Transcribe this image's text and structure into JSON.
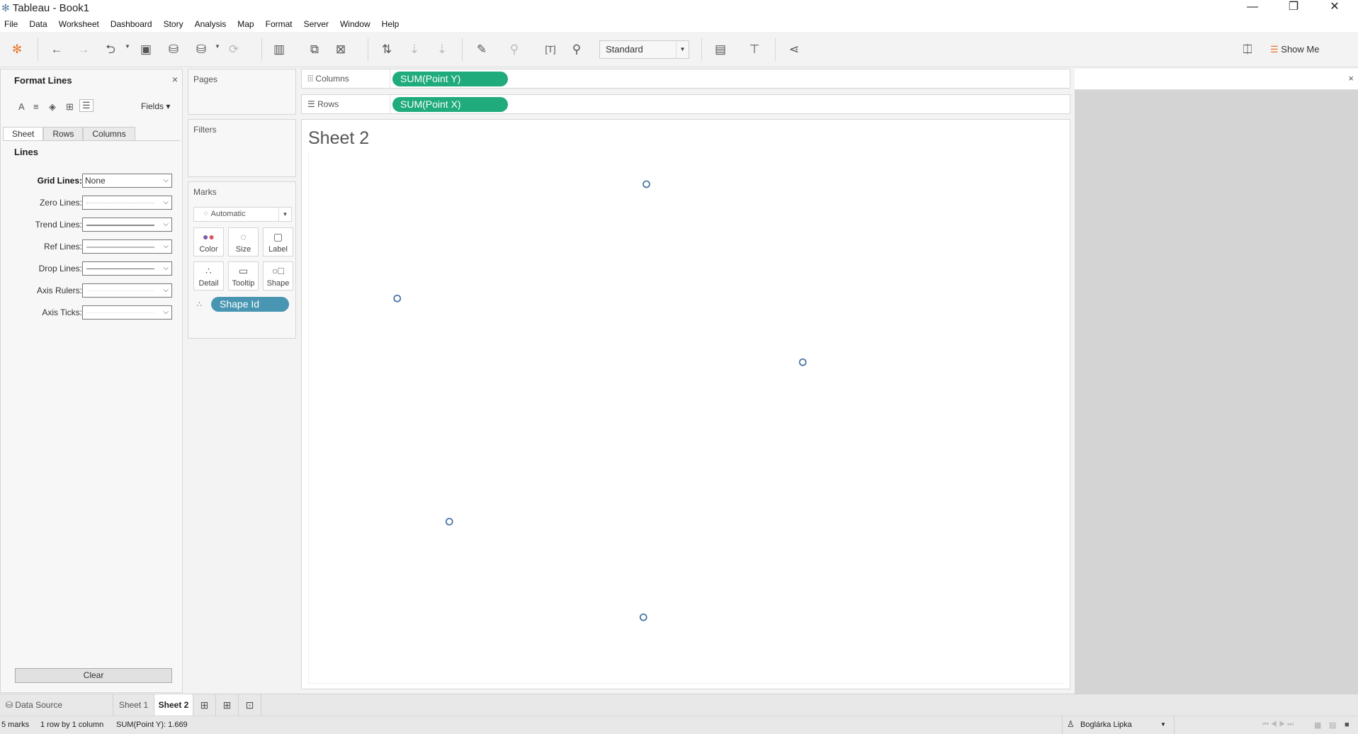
{
  "window": {
    "title": "Tableau - Book1",
    "minimize": "—",
    "restore": "❐",
    "close": "✕"
  },
  "menu": [
    "File",
    "Data",
    "Worksheet",
    "Dashboard",
    "Story",
    "Analysis",
    "Map",
    "Format",
    "Server",
    "Window",
    "Help"
  ],
  "toolbar": {
    "fit": "Standard",
    "show_me": "Show Me"
  },
  "format_panel": {
    "title": "Format Lines",
    "close": "×",
    "fields": "Fields ▾",
    "tabs": [
      "Sheet",
      "Rows",
      "Columns"
    ],
    "section": "Lines",
    "rows": [
      {
        "label": "Grid Lines:",
        "value": "None",
        "style": "none"
      },
      {
        "label": "Zero Lines:",
        "value": "",
        "style": "dotted"
      },
      {
        "label": "Trend Lines:",
        "value": "",
        "style": "solid-thick"
      },
      {
        "label": "Ref Lines:",
        "value": "",
        "style": "solid-light"
      },
      {
        "label": "Drop Lines:",
        "value": "",
        "style": "solid"
      },
      {
        "label": "Axis Rulers:",
        "value": "",
        "style": "faint"
      },
      {
        "label": "Axis Ticks:",
        "value": "",
        "style": "faint"
      }
    ],
    "clear": "Clear"
  },
  "cards": {
    "pages": "Pages",
    "filters": "Filters",
    "marks": "Marks",
    "mark_type": "Automatic",
    "buttons": [
      {
        "label": "Color",
        "icon": "color-icon"
      },
      {
        "label": "Size",
        "icon": "size-icon"
      },
      {
        "label": "Label",
        "icon": "label-icon"
      },
      {
        "label": "Detail",
        "icon": "detail-icon"
      },
      {
        "label": "Tooltip",
        "icon": "tooltip-icon"
      },
      {
        "label": "Shape",
        "icon": "shape-icon"
      }
    ],
    "detail_pill": "Shape Id"
  },
  "shelves": {
    "columns_label": "Columns",
    "columns_pill": "SUM(Point Y)",
    "rows_label": "Rows",
    "rows_pill": "SUM(Point X)"
  },
  "colors": {
    "pill_green": "#1fab7c",
    "pill_blue": "#4996b2",
    "mark": "#4e79a7"
  },
  "chart_data": {
    "type": "scatter",
    "title": "Sheet 2",
    "xlabel": "SUM(Point Y)",
    "ylabel": "SUM(Point X)",
    "grid": false,
    "xlim": [
      0,
      1
    ],
    "ylim": [
      0,
      1
    ],
    "points": [
      {
        "x": 0.447,
        "y": 0.94
      },
      {
        "x": 0.117,
        "y": 0.725
      },
      {
        "x": 0.654,
        "y": 0.605
      },
      {
        "x": 0.186,
        "y": 0.305
      },
      {
        "x": 0.443,
        "y": 0.125
      }
    ]
  },
  "sheet_tabs": {
    "data_source": "Data Source",
    "sheets": [
      "Sheet 1",
      "Sheet 2"
    ],
    "active": "Sheet 2"
  },
  "status": {
    "marks": "5 marks",
    "dims": "1 row by 1 column",
    "sum": "SUM(Point Y): 1.669",
    "user": "Boglárka Lipka"
  }
}
